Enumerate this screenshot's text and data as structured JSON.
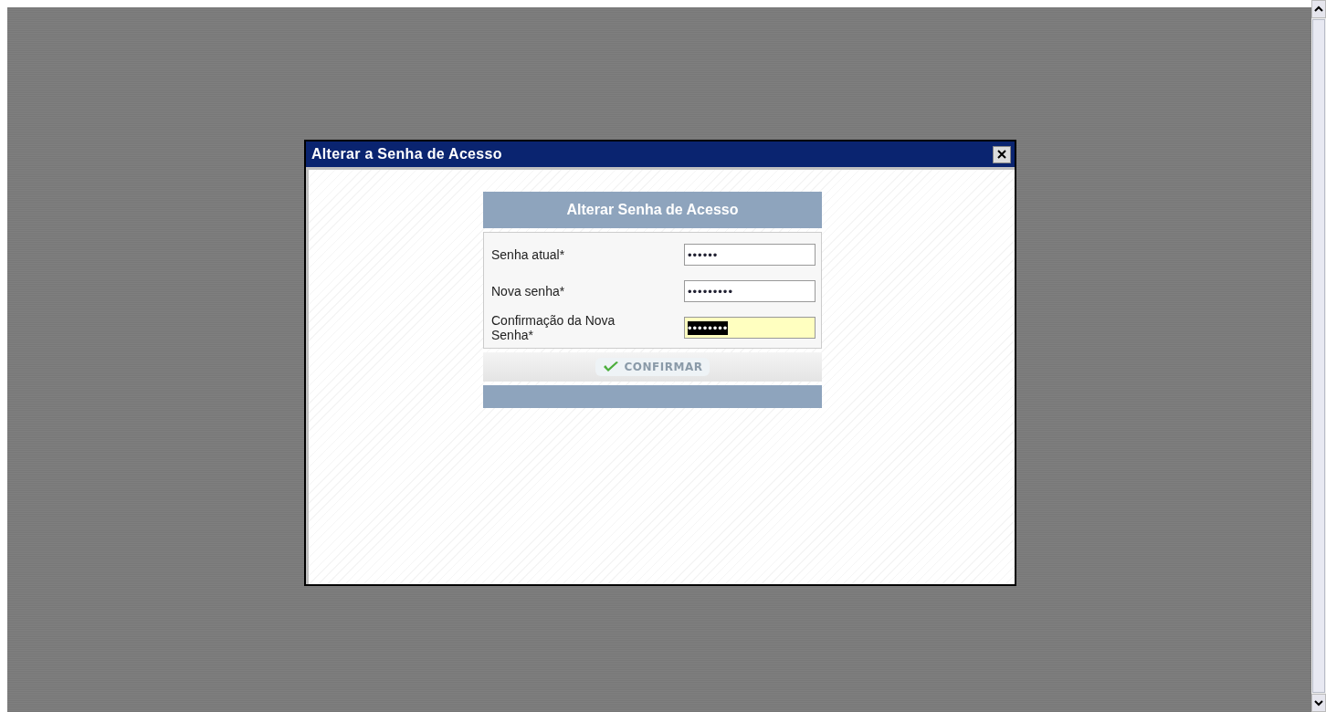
{
  "dialog": {
    "title": "Alterar a Senha de Acesso"
  },
  "form": {
    "heading": "Alterar Senha de Acesso",
    "fields": [
      {
        "label": "Senha atual*",
        "value": "••••••",
        "focused": false
      },
      {
        "label": "Nova senha*",
        "value": "•••••••••",
        "focused": false
      },
      {
        "label": "Confirmação da Nova Senha*",
        "value": "••••••••",
        "focused": true
      }
    ],
    "button": "CONFIRMAR"
  }
}
